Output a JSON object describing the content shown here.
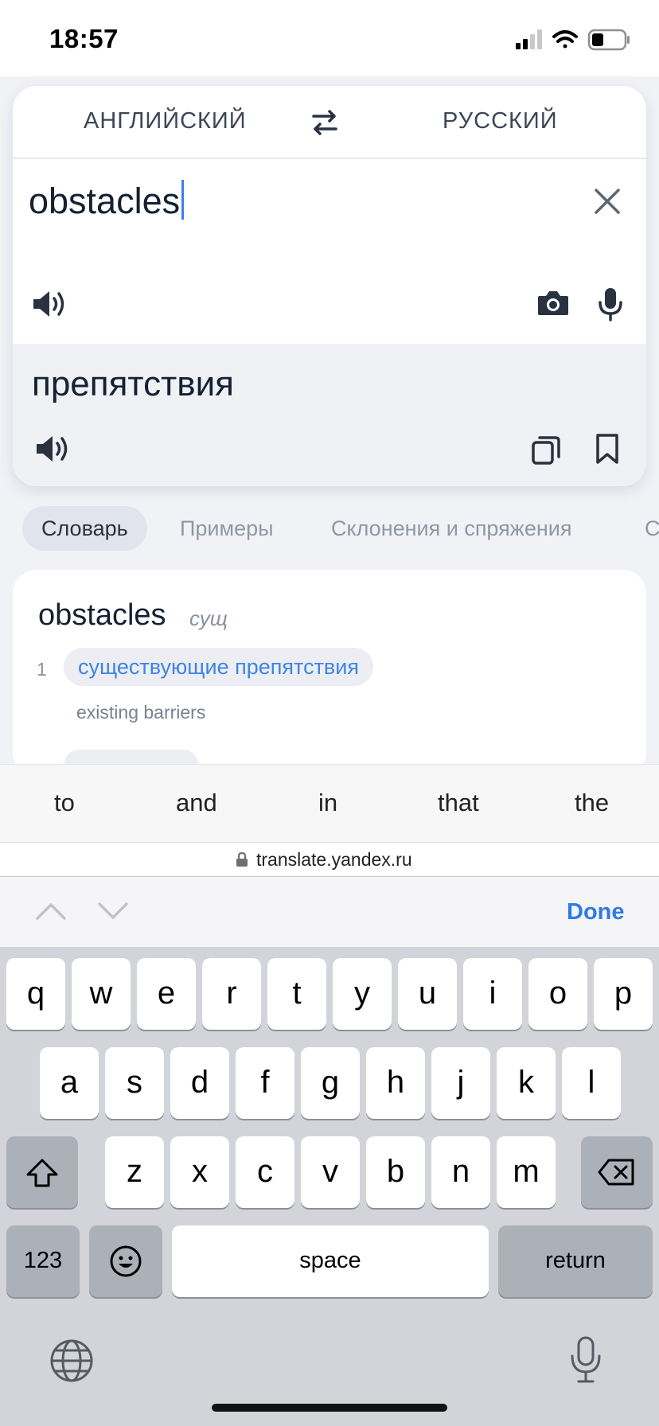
{
  "status": {
    "time": "18:57"
  },
  "translator": {
    "source_lang": "АНГЛИЙСКИЙ",
    "target_lang": "РУССКИЙ",
    "source_text": "obstacles",
    "result_text": "препятствия"
  },
  "tabs": [
    "Словарь",
    "Примеры",
    "Склонения и спряжения",
    "С"
  ],
  "dictionary": {
    "word": "obstacles",
    "pos": "сущ",
    "entries": [
      {
        "num": "1",
        "translation": "существующие препятствия",
        "example": "existing barriers"
      }
    ]
  },
  "suggestions": [
    "to",
    "and",
    "in",
    "that",
    "the"
  ],
  "browser": {
    "url": "translate.yandex.ru",
    "done_label": "Done"
  },
  "keyboard": {
    "row1": [
      "q",
      "w",
      "e",
      "r",
      "t",
      "y",
      "u",
      "i",
      "o",
      "p"
    ],
    "row2": [
      "a",
      "s",
      "d",
      "f",
      "g",
      "h",
      "j",
      "k",
      "l"
    ],
    "row3": [
      "z",
      "x",
      "c",
      "v",
      "b",
      "n",
      "m"
    ],
    "numbers_label": "123",
    "space_label": "space",
    "return_label": "return"
  },
  "colors": {
    "accent": "#2f7be3",
    "link": "#3f84e5",
    "caret": "#3d7ef0"
  }
}
